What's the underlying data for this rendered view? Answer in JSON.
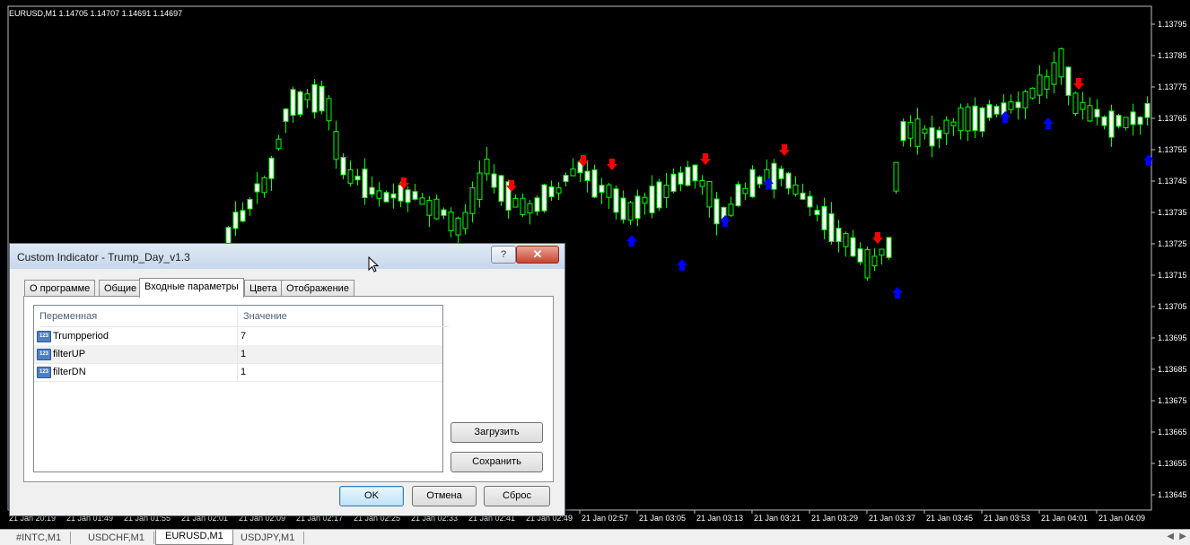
{
  "chart": {
    "symbol_info": "EURUSD,M1  1.14705 1.14707 1.14691 1.14697",
    "price_labels": [
      "1.13795",
      "1.13785",
      "1.13775",
      "1.13765",
      "1.13755",
      "1.13745",
      "1.13735",
      "1.13725",
      "1.13715",
      "1.13705",
      "1.13695",
      "1.13685",
      "1.13675",
      "1.13665",
      "1.13655",
      "1.13645"
    ],
    "time_labels_visible": [
      "21 Jan 02:57",
      "21 Jan 03:05",
      "21 Jan 03:13",
      "21 Jan 03:21",
      "21 Jan 03:29",
      "21 Jan 03:37",
      "21 Jan 03:45",
      "21 Jan 03:53",
      "21 Jan 04:01",
      "21 Jan 04:09"
    ],
    "time_labels_partial": [
      "21 Jan 20:19",
      "21 Jan 01:49",
      "21 Jan 01:55",
      "21 Jan 02:01",
      "21 Jan 02:09",
      "21 Jan 02:17",
      "21 Jan 02:25",
      "21 Jan 02:33",
      "21 Jan 02:41",
      "21 Jan 02:49"
    ],
    "colors": {
      "background": "#000000",
      "bull_body": "#000000",
      "bear_body": "#ffffff",
      "wick": "#00ff00",
      "up_arrow": "#0000ff",
      "down_arrow": "#ff0000",
      "text": "#ffffff"
    },
    "price_range": [
      1.1364,
      1.138
    ]
  },
  "symbol_tabs": [
    "#INTC,M1",
    "USDCHF,M1",
    "EURUSD,M1",
    "USDJPY,M1"
  ],
  "active_symbol_tab": "EURUSD,M1",
  "dialog": {
    "title": "Custom Indicator - Trump_Day_v1.3",
    "help_label": "?",
    "close_label": "✕",
    "tabs": [
      "О программе",
      "Общие",
      "Входные параметры",
      "Цвета",
      "Отображение"
    ],
    "active_tab": "Входные параметры",
    "table": {
      "columns": [
        "Переменная",
        "Значение"
      ],
      "rows": [
        {
          "icon": "123",
          "name": "Trumpperiod",
          "value": "7"
        },
        {
          "icon": "123",
          "name": "filterUP",
          "value": "1"
        },
        {
          "icon": "123",
          "name": "filterDN",
          "value": "1"
        }
      ]
    },
    "load_button": "Загрузить",
    "save_button": "Сохранить",
    "ok_button": "OK",
    "cancel_button": "Отмена",
    "reset_button": "Сброс"
  }
}
